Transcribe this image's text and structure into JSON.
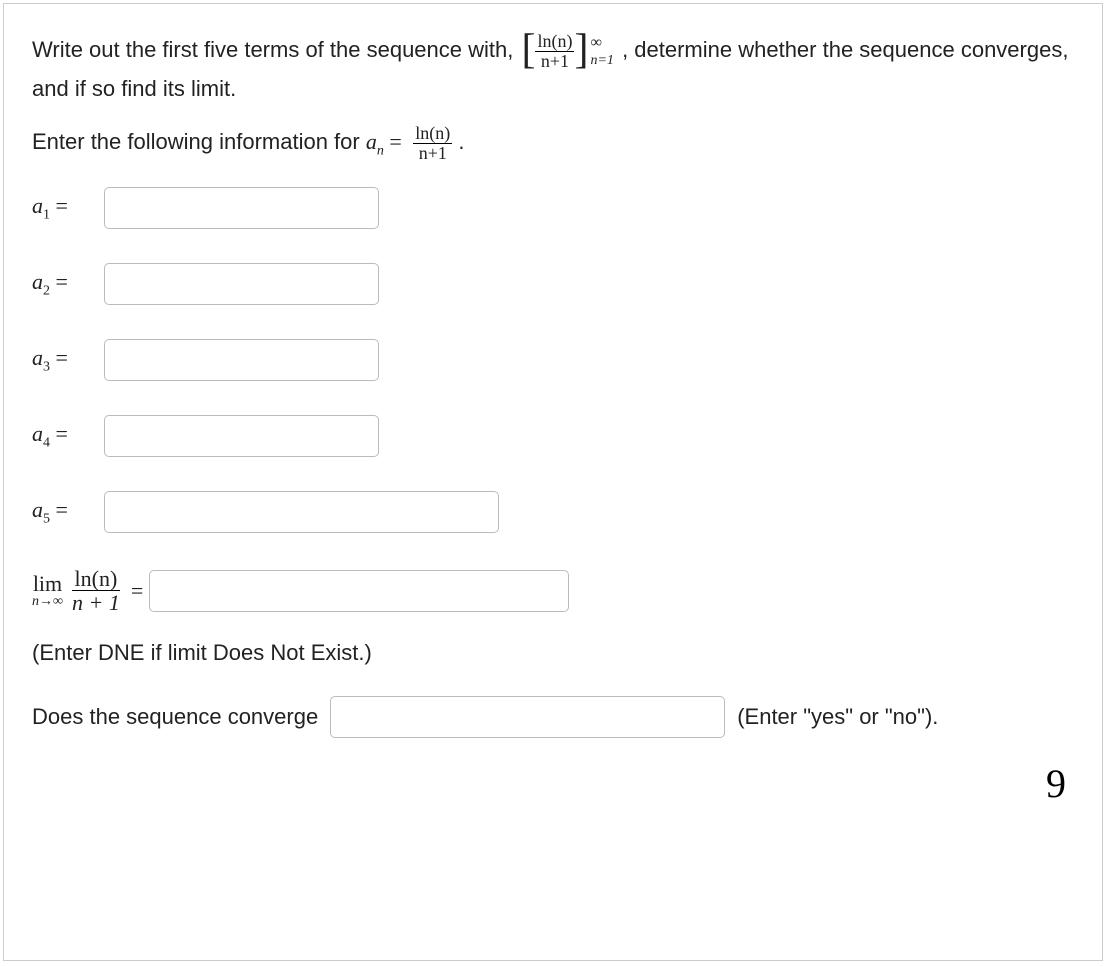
{
  "question": {
    "part1": "Write out the first five terms of the sequence with, ",
    "bracket_num": "ln(n)",
    "bracket_den": "n+1",
    "bracket_sup": "∞",
    "bracket_sub": "n=1",
    "part2": ", determine whether the sequence converges, and if so find its limit."
  },
  "enter_info": {
    "text": "Enter the following information for ",
    "an": "a",
    "an_sub": "n",
    "equals": " = ",
    "frac_num": "ln(n)",
    "frac_den": "n+1",
    "period": "."
  },
  "rows": {
    "a1": {
      "label": "a",
      "sub": "1",
      "eq": " = "
    },
    "a2": {
      "label": "a",
      "sub": "2",
      "eq": " = "
    },
    "a3": {
      "label": "a",
      "sub": "3",
      "eq": " = "
    },
    "a4": {
      "label": "a",
      "sub": "4",
      "eq": " = "
    },
    "a5": {
      "label": "a",
      "sub": "5",
      "eq": " = "
    }
  },
  "limit": {
    "lim": "lim",
    "under": "n→∞",
    "num": "ln(n)",
    "den": "n + 1",
    "eq": " = "
  },
  "hint": "(Enter DNE if limit Does Not Exist.)",
  "converge": {
    "prompt": "Does the sequence converge",
    "after": "(Enter \"yes\" or \"no\")."
  },
  "handwritten": "9"
}
